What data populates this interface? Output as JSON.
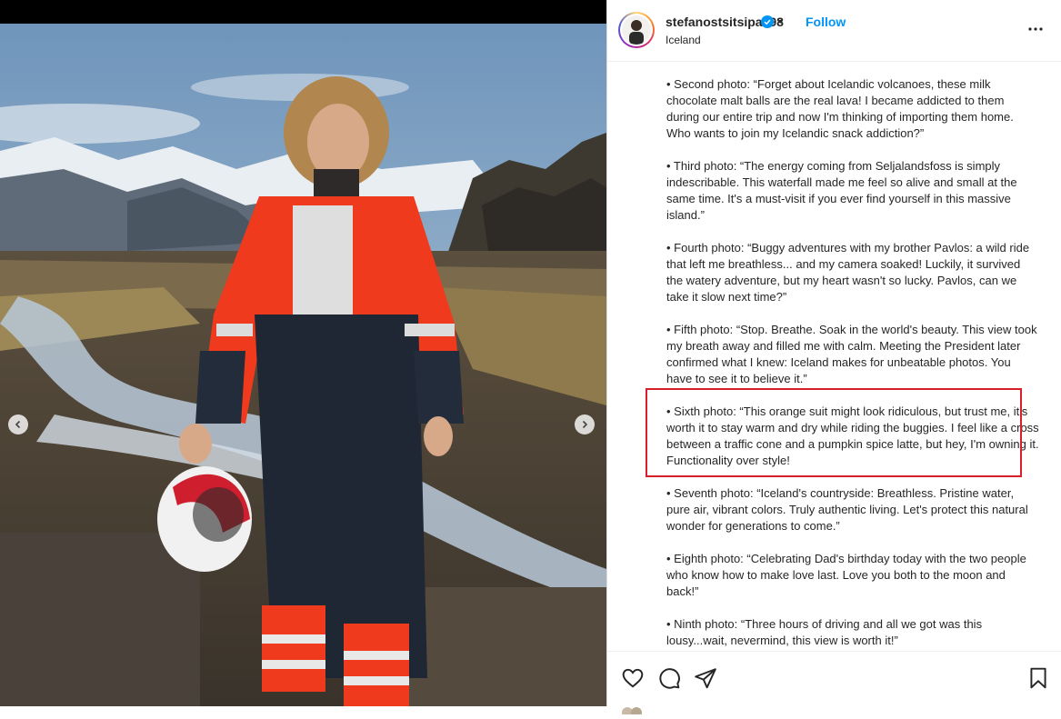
{
  "post": {
    "username": "stefanostsitsipas98",
    "verified_icon": "verified-badge-icon",
    "separator": "•",
    "follow_label": "Follow",
    "location": "Iceland",
    "more_icon": "more-options-icon"
  },
  "caption": {
    "paragraphs": [
      "• Second photo: “Forget about Icelandic volcanoes, these milk chocolate malt balls are the real lava! I became addicted to them during our entire trip and now I'm thinking of importing them home. Who wants to join my Icelandic snack addiction?”",
      "• Third photo: “The energy coming from Seljalandsfoss is simply indescribable. This waterfall made me feel so alive and small at the same time. It's a must-visit if you ever find yourself in this massive island.”",
      "• Fourth photo: “Buggy adventures with my brother Pavlos: a wild ride that left me breathless... and my camera soaked! Luckily, it survived the watery adventure, but my heart wasn't so lucky. Pavlos, can we take it slow next time?”",
      "• Fifth photo: “Stop. Breathe. Soak in the world's beauty. This view took my breath away and filled me with calm. Meeting the President later confirmed what I knew: Iceland makes for unbeatable photos. You have to see it to believe it.”",
      "• Sixth photo: “This orange suit might look ridiculous, but trust me, it's worth it to stay warm and dry while riding the buggies. I feel like a cross between a traffic cone and a pumpkin spice latte, but hey, I'm owning it. Functionality over style!",
      "• Seventh photo: “Iceland's countryside: Breathless. Pristine water, pure air, vibrant colors. Truly authentic living. Let's protect this natural wonder for generations to come.”",
      "• Eighth photo: “Celebrating Dad's birthday today with the two people who know how to make love last. Love you both to the moon and back!”",
      "• Ninth photo: “Three hours of driving and all we got was this lousy...wait, nevermind, this view is worth it!”"
    ],
    "highlight_color": "#d9202a"
  },
  "actions": {
    "like_icon": "heart-icon",
    "comment_icon": "comment-icon",
    "share_icon": "share-icon",
    "save_icon": "bookmark-icon"
  },
  "carousel": {
    "prev_icon": "chevron-left-icon",
    "next_icon": "chevron-right-icon"
  },
  "colors": {
    "accent": "#0095f6",
    "text": "#262626"
  }
}
